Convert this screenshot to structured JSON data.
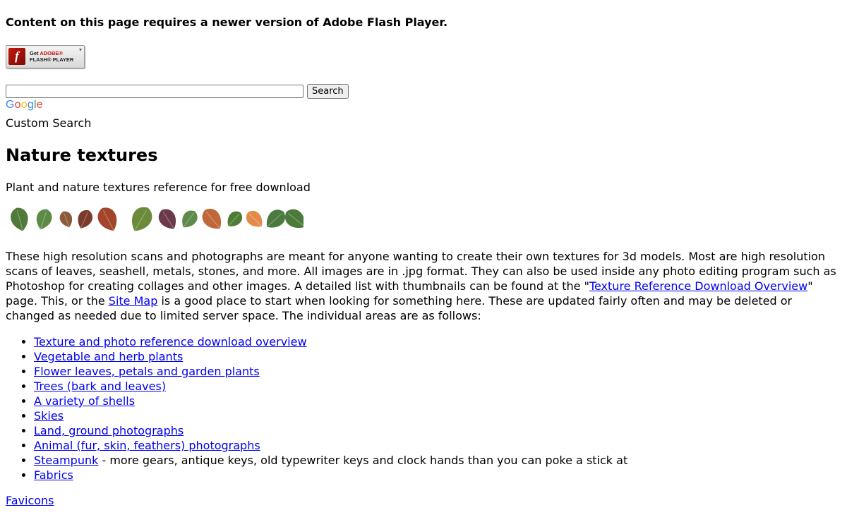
{
  "flash": {
    "message": "Content on this page requires a newer version of Adobe Flash Player.",
    "badge_line1_prefix": "Get ",
    "badge_line1_brand": "ADOBE®",
    "badge_line2": "FLASH® PLAYER",
    "logo_glyph": "f"
  },
  "search": {
    "input_value": "",
    "button_label": "Search",
    "google_letters": [
      "G",
      "o",
      "o",
      "g",
      "l",
      "e"
    ],
    "custom_label": "Custom Search"
  },
  "page": {
    "title": "Nature textures",
    "subtitle": "Plant and nature textures reference for free download"
  },
  "intro": {
    "part1": "These high resolution scans and photographs are meant for anyone wanting to create their own textures for 3d models. Most are high resolution scans of leaves, seashell, metals, stones, and more. All images are in .jpg format. They can also be used inside any photo editing program such as Photoshop for creating collages and other images. A detailed list with thumbnails can be found at the \"",
    "link1": "Texture Reference Download Overview",
    "part2": "\" page. This, or the ",
    "link2": "Site Map",
    "part3": " is a good place to start when looking for something here. These are updated fairly often and may be deleted or changed as needed due to limited server space. The individual areas are as follows:"
  },
  "sections": [
    {
      "label": "Texture and photo reference download overview",
      "note": ""
    },
    {
      "label": "Vegetable and herb plants",
      "note": ""
    },
    {
      "label": "Flower leaves, petals and garden plants",
      "note": ""
    },
    {
      "label": "Trees (bark and leaves)",
      "note": ""
    },
    {
      "label": "A variety of shells",
      "note": ""
    },
    {
      "label": "Skies",
      "note": ""
    },
    {
      "label": "Land, ground photographs",
      "note": ""
    },
    {
      "label": "Animal (fur, skin, feathers) photographs",
      "note": ""
    },
    {
      "label": "Steampunk",
      "note": " - more gears, antique keys, old typewriter keys and clock hands than you can poke a stick at"
    },
    {
      "label": "Fabrics",
      "note": ""
    }
  ],
  "footer": {
    "favicons_link": "Favicons"
  },
  "leaf_colors": [
    "#4f7a3a",
    "#5d8a45",
    "#8a5a3a",
    "#7a3b2a",
    "#a2452a",
    "#6b8a3a",
    "#6b3a4a",
    "#5e8a4a",
    "#c0683a",
    "#4d7d35",
    "#e38a4a",
    "#4a7a40",
    "#4b7a3b"
  ],
  "colors": {
    "link": "#0000ee"
  }
}
